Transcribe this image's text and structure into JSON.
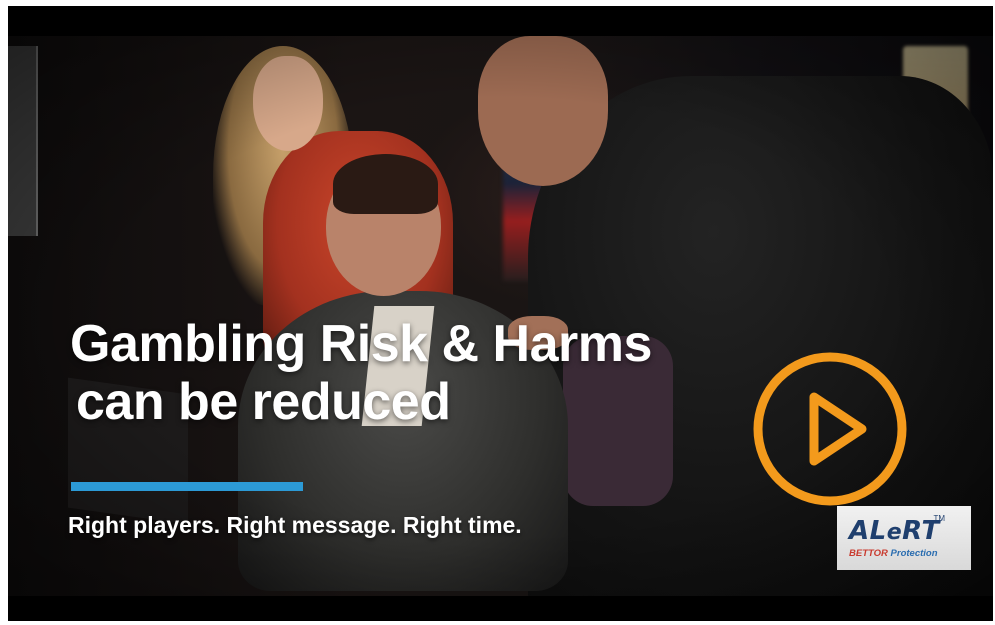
{
  "video": {
    "headline_line1": "Gambling Risk & Harms",
    "headline_line2": "can be reduced",
    "tagline": "Right players. Right message. Right time.",
    "accent_color": "#2c9ad6",
    "play_button_color": "#f39a1c",
    "play_icon": "play-icon"
  },
  "logo": {
    "word_a": "AL",
    "word_e": "e",
    "word_b": "RT",
    "tm": "TM",
    "sub_bettor": "BETTOR",
    "sub_rest": " Protection"
  }
}
